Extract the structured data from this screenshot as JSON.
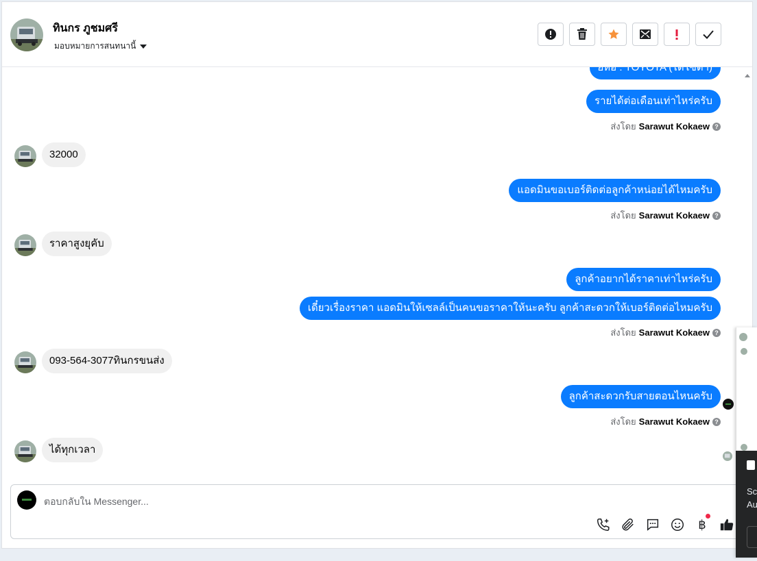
{
  "header": {
    "contact_name": "ทินกร ภูชมศรี",
    "assign_label": "มอบหมายการสนทนานี้"
  },
  "actions": [
    {
      "name": "report-spam-icon",
      "title": "Spam"
    },
    {
      "name": "trash-icon",
      "title": "Delete"
    },
    {
      "name": "star-icon",
      "title": "Follow up"
    },
    {
      "name": "unread-mail-icon",
      "title": "Mark as unread"
    },
    {
      "name": "priority-icon",
      "title": "Priority"
    },
    {
      "name": "check-icon",
      "title": "Done"
    }
  ],
  "thread": {
    "partial_top": "ยี่ห้อ : TOYOTA (ไดโซ่ดา)",
    "messages": [
      {
        "dir": "out",
        "text": "รายได้ต่อเดือนเท่าไหร่ครับ"
      },
      {
        "dir": "in",
        "text": "32000"
      },
      {
        "dir": "out",
        "text": "แอดมินขอเบอร์ติดต่อลูกค้าหน่อยได้ไหมครับ"
      },
      {
        "dir": "in",
        "text": "ราคาสูงยุคับ"
      },
      {
        "dir": "out",
        "text": "ลูกค้าอยากได้ราคาเท่าไหร่ครับ"
      },
      {
        "dir": "out",
        "text": "เดี๋ยวเรื่องราคา แอดมินให้เซลล์เป็นคนขอราคาให้นะครับ ลูกค้าสะดวกให้เบอร์ติดต่อไหมครับ"
      },
      {
        "dir": "in",
        "text": "093-564-3077ทินกรขนส่ง"
      },
      {
        "dir": "out",
        "text": "ลูกค้าสะดวกรับสายตอนไหนครับ"
      },
      {
        "dir": "in",
        "text": "ได้ทุกเวลา"
      }
    ],
    "sent_by_prefix": "ส่งโดย",
    "sent_by_name": "Sarawut Kokaew",
    "help_glyph": "?"
  },
  "composer": {
    "placeholder": "ตอบกลับใน Messenger...",
    "tools": [
      "call-add-icon",
      "attachment-icon",
      "saved-reply-icon",
      "emoji-icon",
      "payment-baht-icon",
      "like-icon"
    ],
    "baht_glyph": "฿"
  },
  "side_panel": {
    "dark_lines": [
      "Sc",
      "Au"
    ]
  },
  "colors": {
    "outgoing_bubble": "#0a7cff",
    "incoming_bubble": "#f0f0f0",
    "star": "#f7923b",
    "priority": "#e41e3f"
  }
}
